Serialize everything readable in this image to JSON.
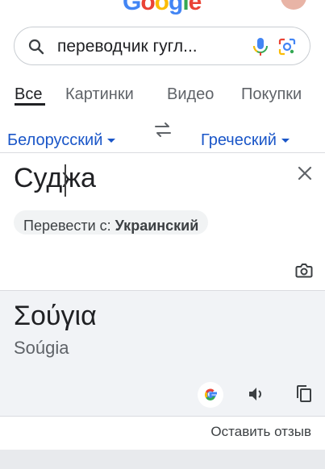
{
  "header": {
    "logo_text": "Google",
    "logo_colors": [
      "#4285F4",
      "#EA4335",
      "#FBBC05",
      "#4285F4",
      "#34A853",
      "#EA4335"
    ]
  },
  "search": {
    "query": "переводчик гугл...",
    "icons": [
      "search-icon",
      "mic-icon",
      "lens-icon"
    ]
  },
  "tabs": [
    {
      "label": "Все",
      "active": true
    },
    {
      "label": "Картинки",
      "active": false
    },
    {
      "label": "Видео",
      "active": false
    },
    {
      "label": "Покупки",
      "active": false
    }
  ],
  "translator": {
    "source_lang": "Белорусский",
    "target_lang": "Греческий",
    "source_text": "Суджа",
    "detected_prefix": "Перевести с:",
    "detected_lang": "Украинский",
    "result_text": "Σούγια",
    "transliteration": "Soúgia",
    "feedback": "Оставить отзыв"
  },
  "colors": {
    "accent": "#1a56c8",
    "result_bg": "#f1f3f6",
    "divider": "#dadce0"
  }
}
